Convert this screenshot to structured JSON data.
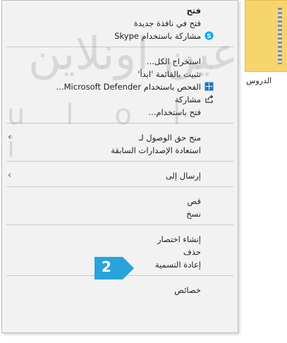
{
  "folder": {
    "label": "الدروس"
  },
  "watermark": {
    "arabic": "عين اونلاين",
    "latin": "ulol i"
  },
  "menu": {
    "items": {
      "open": {
        "label": "فتح"
      },
      "open_new_window": {
        "label": "فتح في نافذة جديدة"
      },
      "share_skype": {
        "label": "مشاركة باستخدام Skype"
      },
      "extract_all": {
        "label": "استخراج الكل..."
      },
      "pin_start": {
        "label": "تثبيت بالقائمة 'ابدأ'"
      },
      "scan_defender": {
        "label": "الفحص باستخدام Microsoft Defender..."
      },
      "share": {
        "label": "مشاركة"
      },
      "open_with": {
        "label": "فتح باستخدام..."
      },
      "give_access": {
        "label": "منح حق الوصول لـ"
      },
      "restore_versions": {
        "label": "استعادة الإصدارات السابقة"
      },
      "send_to": {
        "label": "إرسال إلى"
      },
      "cut": {
        "label": "قص"
      },
      "copy": {
        "label": "نسخ"
      },
      "create_shortcut": {
        "label": "إنشاء اختصار"
      },
      "delete": {
        "label": "حذف"
      },
      "rename": {
        "label": "إعادة التسمية"
      },
      "properties": {
        "label": "خصائص"
      }
    }
  },
  "step_badge": {
    "number": "2",
    "color": "#29a3dc"
  },
  "colors": {
    "menu_bg": "#f2f2f2",
    "skype_blue": "#00a9f0",
    "defender_blue": "#1e74c7"
  }
}
